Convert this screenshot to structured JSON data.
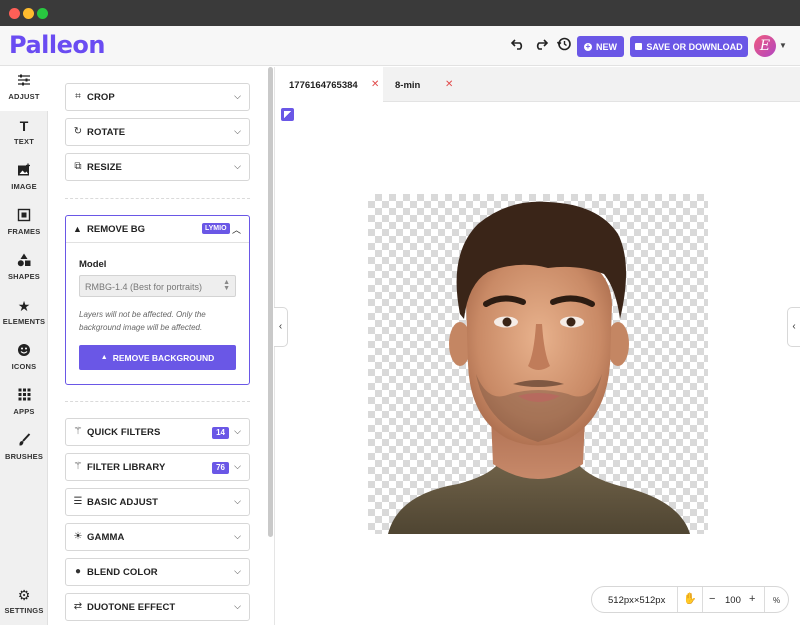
{
  "app": {
    "logo": "Palleon"
  },
  "header": {
    "undo_icon": "undo-icon",
    "redo_icon": "redo-icon",
    "history_icon": "history-icon",
    "new_label": "NEW",
    "save_label": "SAVE OR DOWNLOAD",
    "avatar_letter": "E"
  },
  "leftnav": {
    "items": [
      {
        "label": "ADJUST",
        "icon": "sliders-icon"
      },
      {
        "label": "TEXT",
        "icon": "text-icon"
      },
      {
        "label": "IMAGE",
        "icon": "image-icon"
      },
      {
        "label": "FRAMES",
        "icon": "frames-icon"
      },
      {
        "label": "SHAPES",
        "icon": "shapes-icon"
      },
      {
        "label": "ELEMENTS",
        "icon": "star-icon"
      },
      {
        "label": "ICONS",
        "icon": "smiley-icon"
      },
      {
        "label": "APPS",
        "icon": "apps-grid-icon"
      },
      {
        "label": "BRUSHES",
        "icon": "brush-icon"
      }
    ],
    "settings_label": "SETTINGS"
  },
  "panel": {
    "crop": "CROP",
    "rotate": "ROTATE",
    "resize": "RESIZE",
    "remove_bg": {
      "title": "REMOVE BG",
      "tag": "LYMIO",
      "model_label": "Model",
      "model_value": "RMBG-1.4 (Best for portraits)",
      "note": "Layers will not be affected. Only the background image will be affected.",
      "button": "REMOVE BACKGROUND"
    },
    "quick_filters": {
      "label": "QUICK FILTERS",
      "count": "14"
    },
    "filter_library": {
      "label": "FILTER LIBRARY",
      "count": "76"
    },
    "basic_adjust": "BASIC ADJUST",
    "gamma": "GAMMA",
    "blend_color": "BLEND COLOR",
    "duotone": "DUOTONE EFFECT"
  },
  "tabs": [
    {
      "label": "1776164765384"
    },
    {
      "label": "8-min"
    }
  ],
  "status": {
    "dimensions": "512px×512px",
    "zoom": "100",
    "percent": "%"
  },
  "colors": {
    "accent": "#6a57e6",
    "close": "#e14b4b"
  }
}
